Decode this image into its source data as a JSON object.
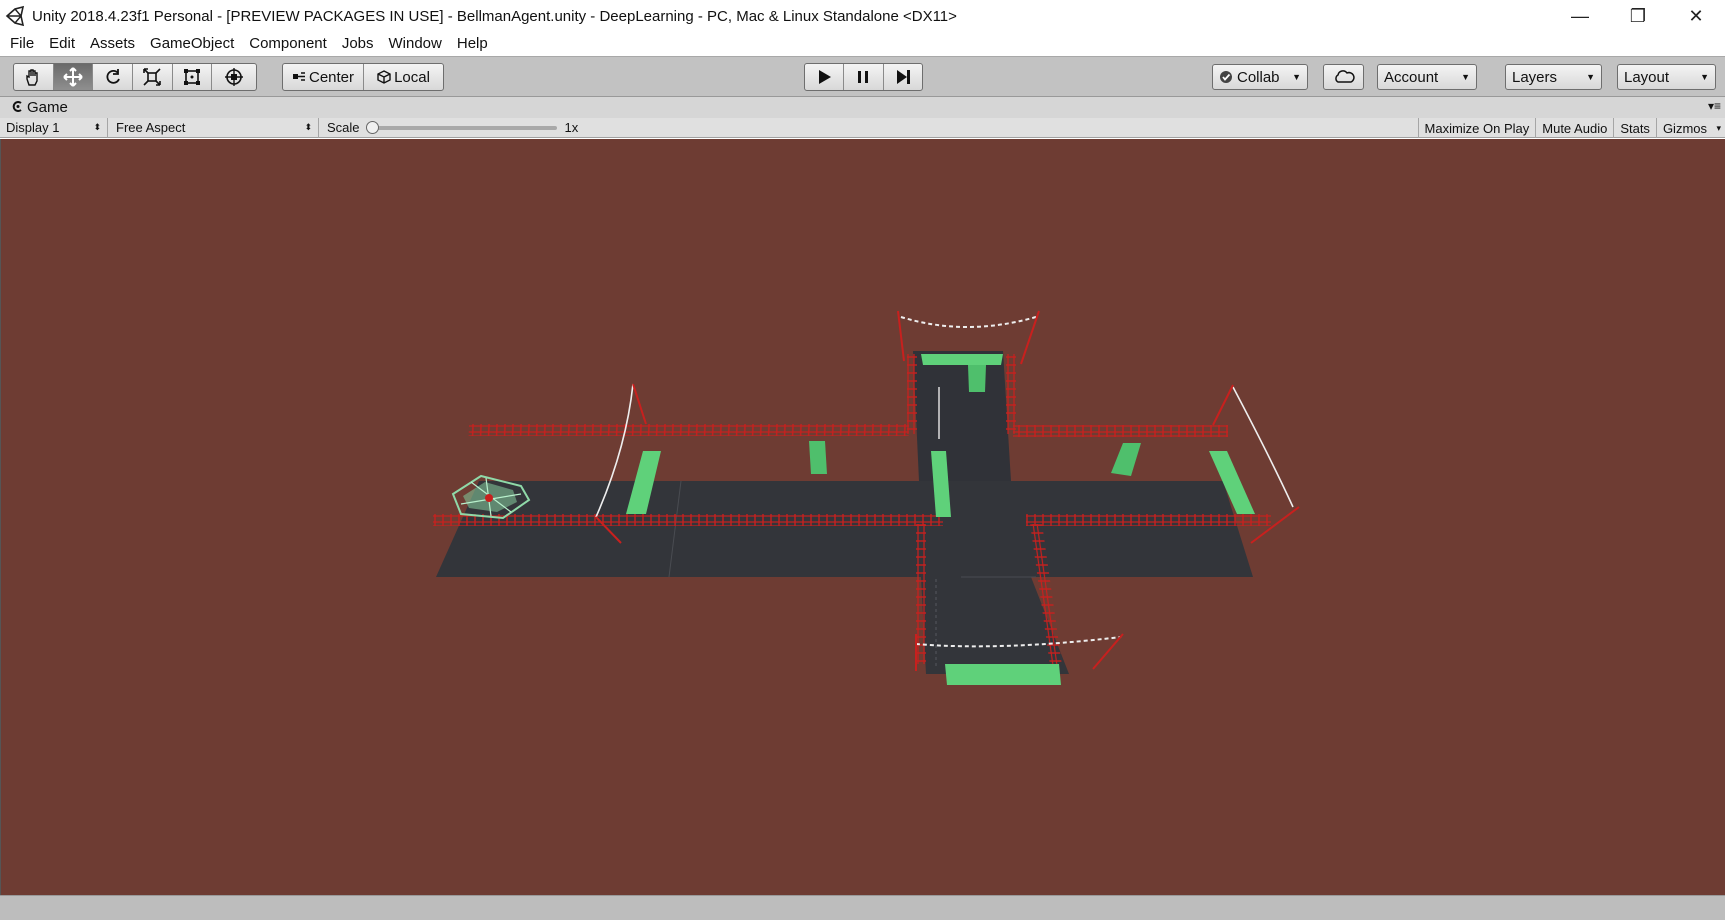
{
  "window": {
    "title": "Unity 2018.4.23f1 Personal - [PREVIEW PACKAGES IN USE] - BellmanAgent.unity - DeepLearning - PC, Mac & Linux Standalone <DX11>",
    "controls": {
      "minimize": "—",
      "restore": "❐",
      "close": "✕"
    }
  },
  "menu": {
    "items": [
      "File",
      "Edit",
      "Assets",
      "GameObject",
      "Component",
      "Jobs",
      "Window",
      "Help"
    ]
  },
  "toolbar": {
    "transform_tools": [
      "hand-tool",
      "move-tool",
      "rotate-tool",
      "scale-tool",
      "rect-tool",
      "transform-tool"
    ],
    "active_tool": "move-tool",
    "pivot_mode": "Center",
    "pivot_rotation": "Local",
    "playback": [
      "play",
      "pause",
      "step"
    ],
    "collab": "Collab",
    "account": "Account",
    "layers": "Layers",
    "layout": "Layout"
  },
  "game_view": {
    "tab_label": "Game",
    "display": "Display 1",
    "aspect": "Free Aspect",
    "scale_label": "Scale",
    "scale_value": "1x",
    "toggles": [
      "Maximize On Play",
      "Mute Audio",
      "Stats",
      "Gizmos"
    ]
  },
  "scene": {
    "background_color": "#6e3c33",
    "floor_color": "#33353a",
    "fence_color": "#c8201e",
    "goal_color": "#5fd17a",
    "agent_color": "#8fd9a8"
  }
}
